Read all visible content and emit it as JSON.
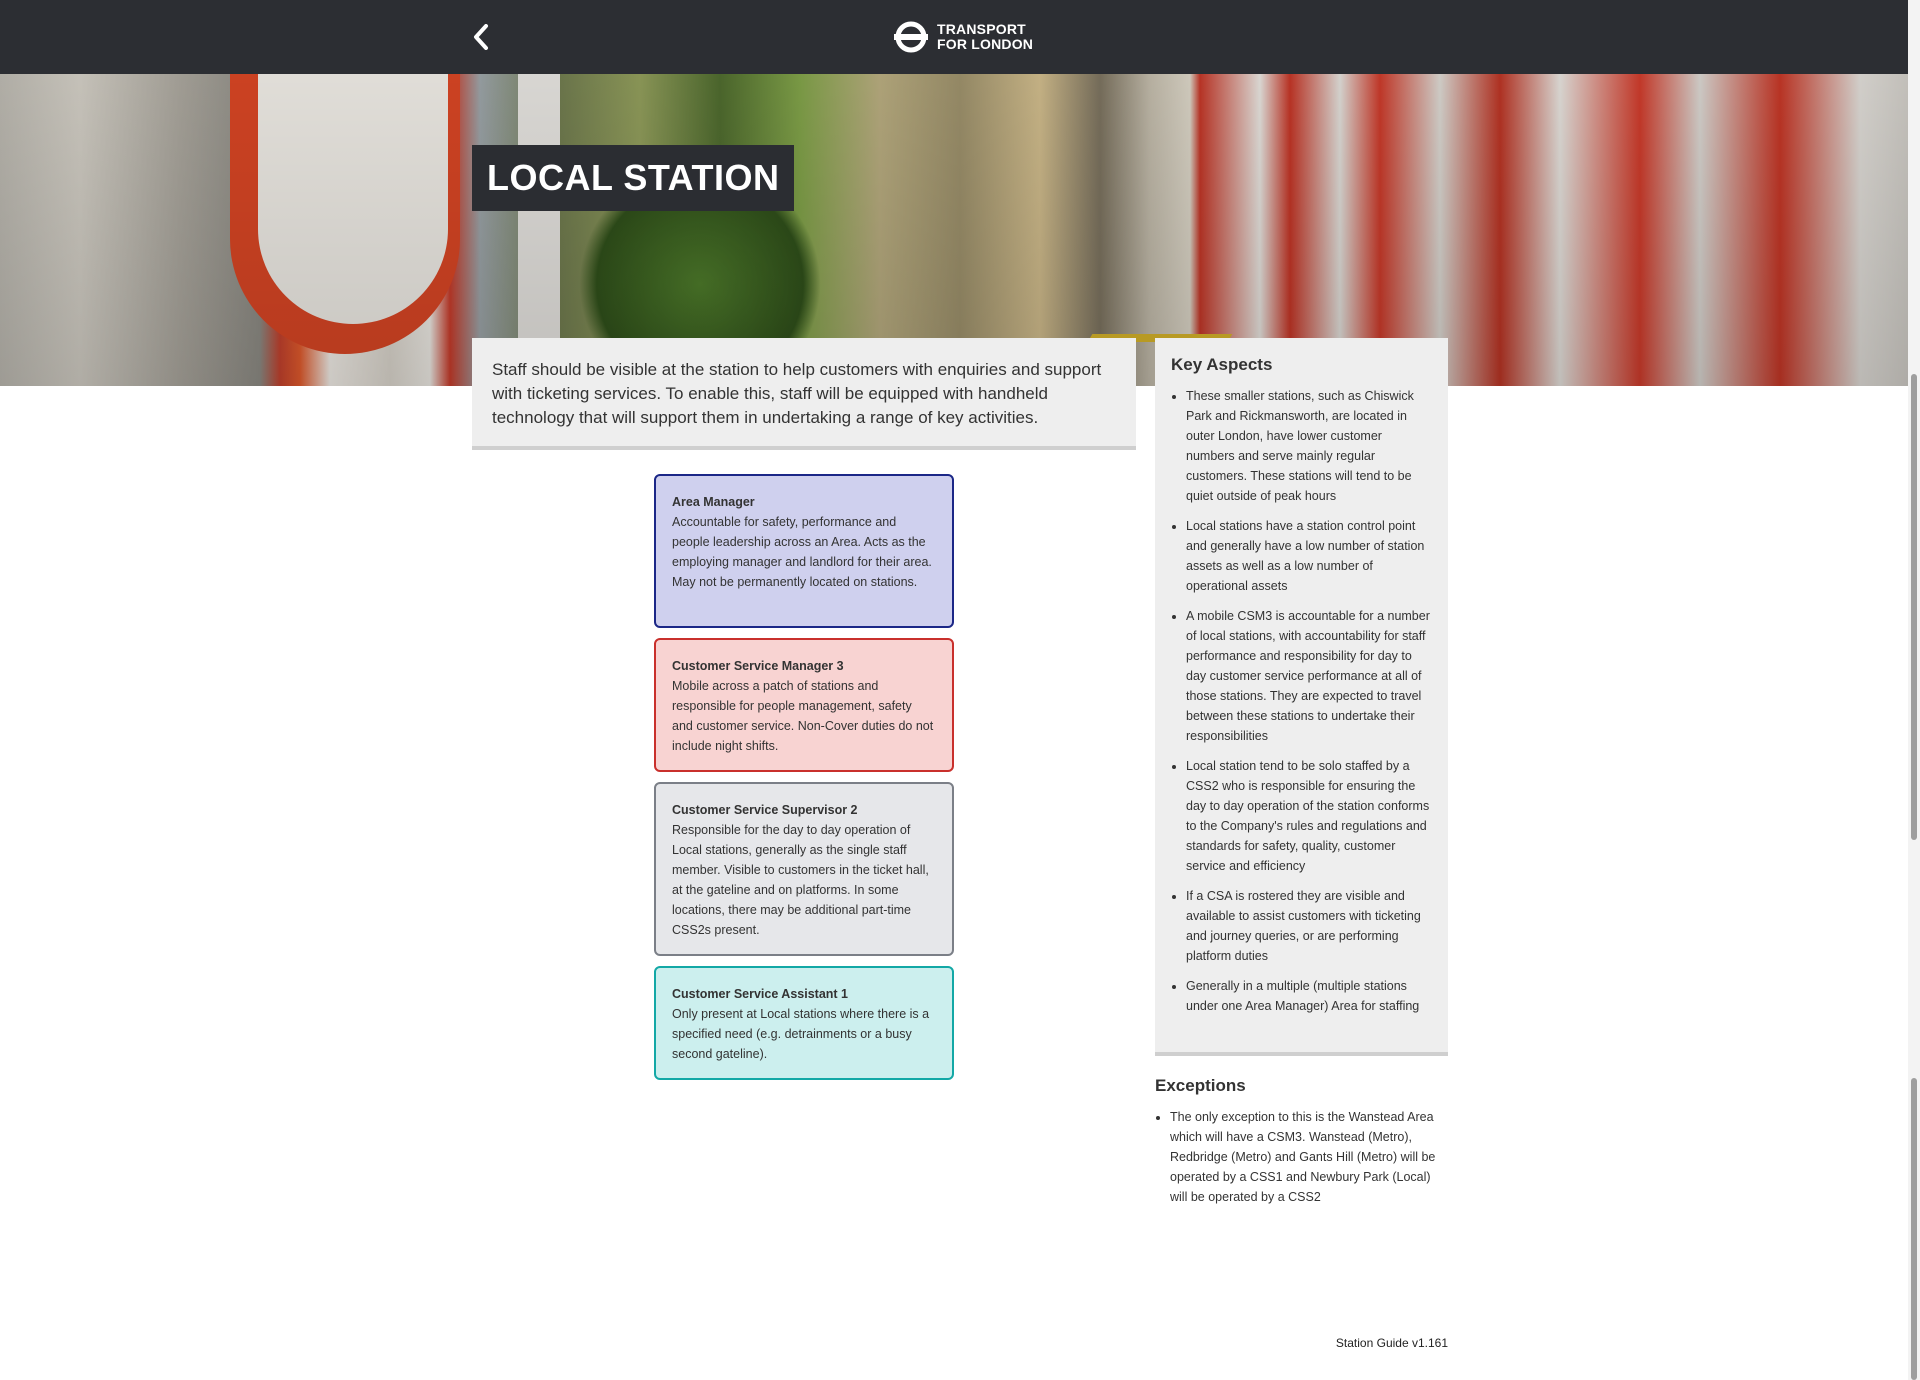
{
  "header": {
    "back_icon": "chevron-left-icon",
    "logo_icon": "tfl-roundel-icon",
    "logo_line1": "TRANSPORT",
    "logo_line2": "FOR LONDON"
  },
  "hero": {
    "title": "LOCAL STATION"
  },
  "intro": {
    "text": "Staff should be visible at the station to help customers with enquiries and support with ticketing services. To enable this, staff will be equipped with handheld technology that will support them in undertaking a range of key activities."
  },
  "roles": [
    {
      "title": "Area Manager",
      "description": "Accountable for safety, performance and people leadership across an Area. Acts as the employing manager and landlord for their area. May not be permanently located on stations.",
      "color": "#cfd0ee",
      "border": "#1b2787"
    },
    {
      "title": "Customer Service Manager 3",
      "description": "Mobile across a patch of stations and responsible for people management, safety and customer service. Non-Cover duties do not include night shifts.",
      "color": "#f8d3d2",
      "border": "#c9302c"
    },
    {
      "title": "Customer Service Supervisor 2",
      "description": "Responsible for the day to day operation of Local stations, generally as the single staff member. Visible to customers in the ticket hall, at the gateline and on platforms. In some locations, there may be additional part-time CSS2s present.",
      "color": "#e6e7ea",
      "border": "#7b7f87"
    },
    {
      "title": "Customer Service Assistant 1",
      "description": "Only present at Local stations where there is a specified need (e.g. detrainments or a busy second gateline).",
      "color": "#ccefee",
      "border": "#13a8a6"
    }
  ],
  "key_aspects": {
    "heading": "Key Aspects",
    "items": [
      "These smaller stations, such as Chiswick Park and Rickmansworth, are located in outer London, have lower customer numbers and serve mainly regular customers. These stations will tend to be quiet outside of peak hours",
      "Local stations have a station control point and generally have a low number of station assets as well as a low number of operational assets",
      "A mobile CSM3 is accountable for a number of local stations, with accountability for staff performance and responsibility for day to day customer service performance at all of those stations. They are expected to travel between these stations to undertake their responsibilities",
      "Local station tend to be solo staffed by a CSS2 who is responsible for ensuring the day to day operation of the station conforms to the Company's rules and regulations and standards for safety, quality, customer service and efficiency",
      "If a CSA is rostered they are visible and available to assist customers with ticketing and journey queries, or are performing platform duties",
      "Generally in a multiple (multiple stations under one Area Manager) Area for staffing"
    ]
  },
  "exceptions": {
    "heading": "Exceptions",
    "items": [
      "The only exception to this is the Wanstead Area which will have a CSM3. Wanstead (Metro), Redbridge (Metro) and Gants Hill (Metro) will be operated by a CSS1 and Newbury Park (Local) will be operated by a CSS2"
    ]
  },
  "footer": {
    "version": "Station Guide v1.161"
  }
}
